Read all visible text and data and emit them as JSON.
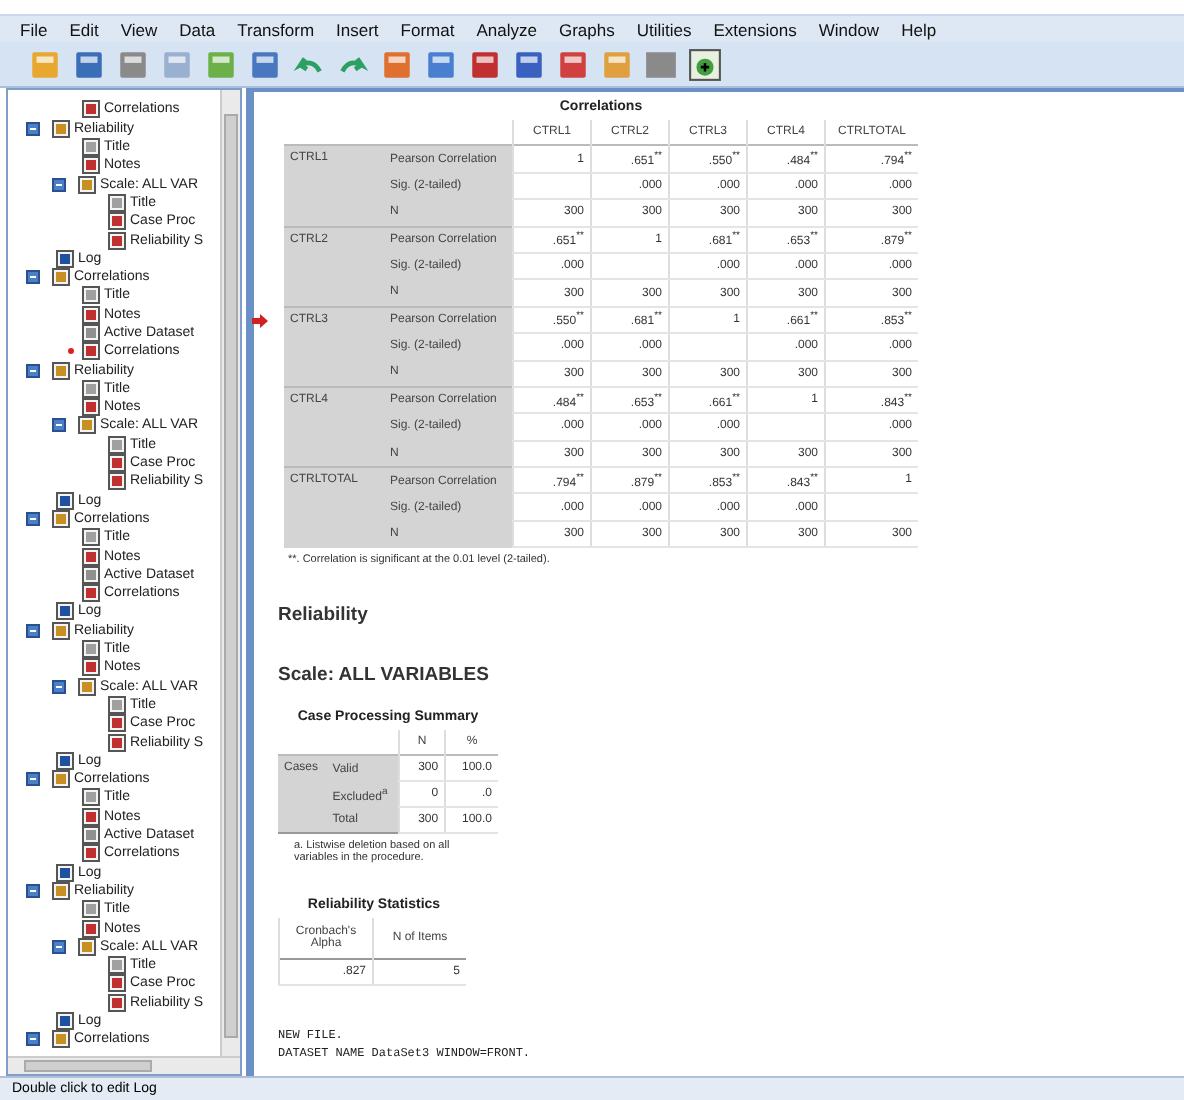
{
  "menu": [
    "File",
    "Edit",
    "View",
    "Data",
    "Transform",
    "Insert",
    "Format",
    "Analyze",
    "Graphs",
    "Utilities",
    "Extensions",
    "Window",
    "Help"
  ],
  "tree": [
    {
      "children": [
        {
          "label": "Correlations",
          "kind": "table"
        }
      ]
    },
    {
      "label": "Reliability",
      "kind": "book",
      "expanded": true,
      "children": [
        {
          "label": "Title",
          "kind": "title"
        },
        {
          "label": "Notes",
          "kind": "notes"
        },
        {
          "label": "Scale: ALL VAR",
          "kind": "book",
          "expanded": true,
          "children": [
            {
              "label": "Title",
              "kind": "title"
            },
            {
              "label": "Case Proc",
              "kind": "table"
            },
            {
              "label": "Reliability S",
              "kind": "table"
            }
          ]
        }
      ]
    },
    {
      "label": "Log",
      "kind": "log"
    },
    {
      "label": "Correlations",
      "kind": "book",
      "expanded": true,
      "children": [
        {
          "label": "Title",
          "kind": "title"
        },
        {
          "label": "Notes",
          "kind": "notes"
        },
        {
          "label": "Active Dataset",
          "kind": "text"
        },
        {
          "label": "Correlations",
          "kind": "table",
          "current": true
        }
      ]
    },
    {
      "label": "Reliability",
      "kind": "book",
      "expanded": true,
      "children": [
        {
          "label": "Title",
          "kind": "title"
        },
        {
          "label": "Notes",
          "kind": "notes"
        },
        {
          "label": "Scale: ALL VAR",
          "kind": "book",
          "expanded": true,
          "children": [
            {
              "label": "Title",
              "kind": "title"
            },
            {
              "label": "Case Proc",
              "kind": "table"
            },
            {
              "label": "Reliability S",
              "kind": "table"
            }
          ]
        }
      ]
    },
    {
      "label": "Log",
      "kind": "log"
    },
    {
      "label": "Correlations",
      "kind": "book",
      "expanded": true,
      "children": [
        {
          "label": "Title",
          "kind": "title"
        },
        {
          "label": "Notes",
          "kind": "notes"
        },
        {
          "label": "Active Dataset",
          "kind": "text"
        },
        {
          "label": "Correlations",
          "kind": "table"
        }
      ]
    },
    {
      "label": "Log",
      "kind": "log"
    },
    {
      "label": "Reliability",
      "kind": "book",
      "expanded": true,
      "children": [
        {
          "label": "Title",
          "kind": "title"
        },
        {
          "label": "Notes",
          "kind": "notes"
        },
        {
          "label": "Scale: ALL VAR",
          "kind": "book",
          "expanded": true,
          "children": [
            {
              "label": "Title",
              "kind": "title"
            },
            {
              "label": "Case Proc",
              "kind": "table"
            },
            {
              "label": "Reliability S",
              "kind": "table"
            }
          ]
        }
      ]
    },
    {
      "label": "Log",
      "kind": "log"
    },
    {
      "label": "Correlations",
      "kind": "book",
      "expanded": true,
      "children": [
        {
          "label": "Title",
          "kind": "title"
        },
        {
          "label": "Notes",
          "kind": "notes"
        },
        {
          "label": "Active Dataset",
          "kind": "text"
        },
        {
          "label": "Correlations",
          "kind": "table"
        }
      ]
    },
    {
      "label": "Log",
      "kind": "log"
    },
    {
      "label": "Reliability",
      "kind": "book",
      "expanded": true,
      "children": [
        {
          "label": "Title",
          "kind": "title"
        },
        {
          "label": "Notes",
          "kind": "notes"
        },
        {
          "label": "Scale: ALL VAR",
          "kind": "book",
          "expanded": true,
          "children": [
            {
              "label": "Title",
              "kind": "title"
            },
            {
              "label": "Case Proc",
              "kind": "table"
            },
            {
              "label": "Reliability S",
              "kind": "table"
            }
          ]
        }
      ]
    },
    {
      "label": "Log",
      "kind": "log"
    },
    {
      "label": "Correlations",
      "kind": "book",
      "expanded": true
    }
  ],
  "correlations": {
    "title": "Correlations",
    "columns": [
      "CTRL1",
      "CTRL2",
      "CTRL3",
      "CTRL4",
      "CTRLTOTAL"
    ],
    "rows": [
      {
        "name": "CTRL1",
        "stats": [
          {
            "label": "Pearson Correlation",
            "cells": [
              "1",
              ".651$^{**}$",
              ".550$^{**}$",
              ".484$^{**}$",
              ".794$^{**}$"
            ]
          },
          {
            "label": "Sig. (2-tailed)",
            "cells": [
              null,
              ".000",
              ".000",
              ".000",
              ".000"
            ]
          },
          {
            "label": "N",
            "cells": [
              "300",
              "300",
              "300",
              "300",
              "300"
            ]
          }
        ]
      },
      {
        "name": "CTRL2",
        "stats": [
          {
            "label": "Pearson Correlation",
            "cells": [
              ".651$^{**}$",
              "1",
              ".681$^{**}$",
              ".653$^{**}$",
              ".879$^{**}$"
            ]
          },
          {
            "label": "Sig. (2-tailed)",
            "cells": [
              ".000",
              null,
              ".000",
              ".000",
              ".000"
            ]
          },
          {
            "label": "N",
            "cells": [
              "300",
              "300",
              "300",
              "300",
              "300"
            ]
          }
        ]
      },
      {
        "name": "CTRL3",
        "current": true,
        "stats": [
          {
            "label": "Pearson Correlation",
            "cells": [
              ".550$^{**}$",
              ".681$^{**}$",
              "1",
              ".661$^{**}$",
              ".853$^{**}$"
            ]
          },
          {
            "label": "Sig. (2-tailed)",
            "cells": [
              ".000",
              ".000",
              null,
              ".000",
              ".000"
            ]
          },
          {
            "label": "N",
            "cells": [
              "300",
              "300",
              "300",
              "300",
              "300"
            ]
          }
        ]
      },
      {
        "name": "CTRL4",
        "stats": [
          {
            "label": "Pearson Correlation",
            "cells": [
              ".484$^{**}$",
              ".653$^{**}$",
              ".661$^{**}$",
              "1",
              ".843$^{**}$"
            ]
          },
          {
            "label": "Sig. (2-tailed)",
            "cells": [
              ".000",
              ".000",
              ".000",
              null,
              ".000"
            ]
          },
          {
            "label": "N",
            "cells": [
              "300",
              "300",
              "300",
              "300",
              "300"
            ]
          }
        ]
      },
      {
        "name": "CTRLTOTAL",
        "stats": [
          {
            "label": "Pearson Correlation",
            "cells": [
              ".794$^{**}$",
              ".879$^{**}$",
              ".853$^{**}$",
              ".843$^{**}$",
              "1"
            ]
          },
          {
            "label": "Sig. (2-tailed)",
            "cells": [
              ".000",
              ".000",
              ".000",
              ".000",
              null
            ]
          },
          {
            "label": "N",
            "cells": [
              "300",
              "300",
              "300",
              "300",
              "300"
            ]
          }
        ]
      }
    ],
    "footnote": "**. Correlation is significant at the 0.01 level (2-tailed)."
  },
  "heading": "Reliability",
  "subheading": "Scale: ALL VARIABLES",
  "case_summary": {
    "title": "Case Processing Summary",
    "columns": [
      "N",
      "%"
    ],
    "group": "Cases",
    "rows": [
      {
        "label": "Valid",
        "cells": [
          "300",
          "100.0"
        ]
      },
      {
        "label": "Excluded$^{a}$",
        "cells": [
          "0",
          ".0"
        ]
      },
      {
        "label": "Total",
        "cells": [
          "300",
          "100.0"
        ]
      }
    ],
    "footnote": "a. Listwise deletion based on all variables in the procedure."
  },
  "reliability_stats": {
    "title": "Reliability Statistics",
    "columns": [
      "Cronbach's Alpha",
      "N of Items"
    ],
    "cells": [
      ".827",
      "5"
    ]
  },
  "log": [
    "NEW FILE.",
    "DATASET NAME DataSet3 WINDOW=FRONT."
  ],
  "status_bar": "Double click to edit Log"
}
